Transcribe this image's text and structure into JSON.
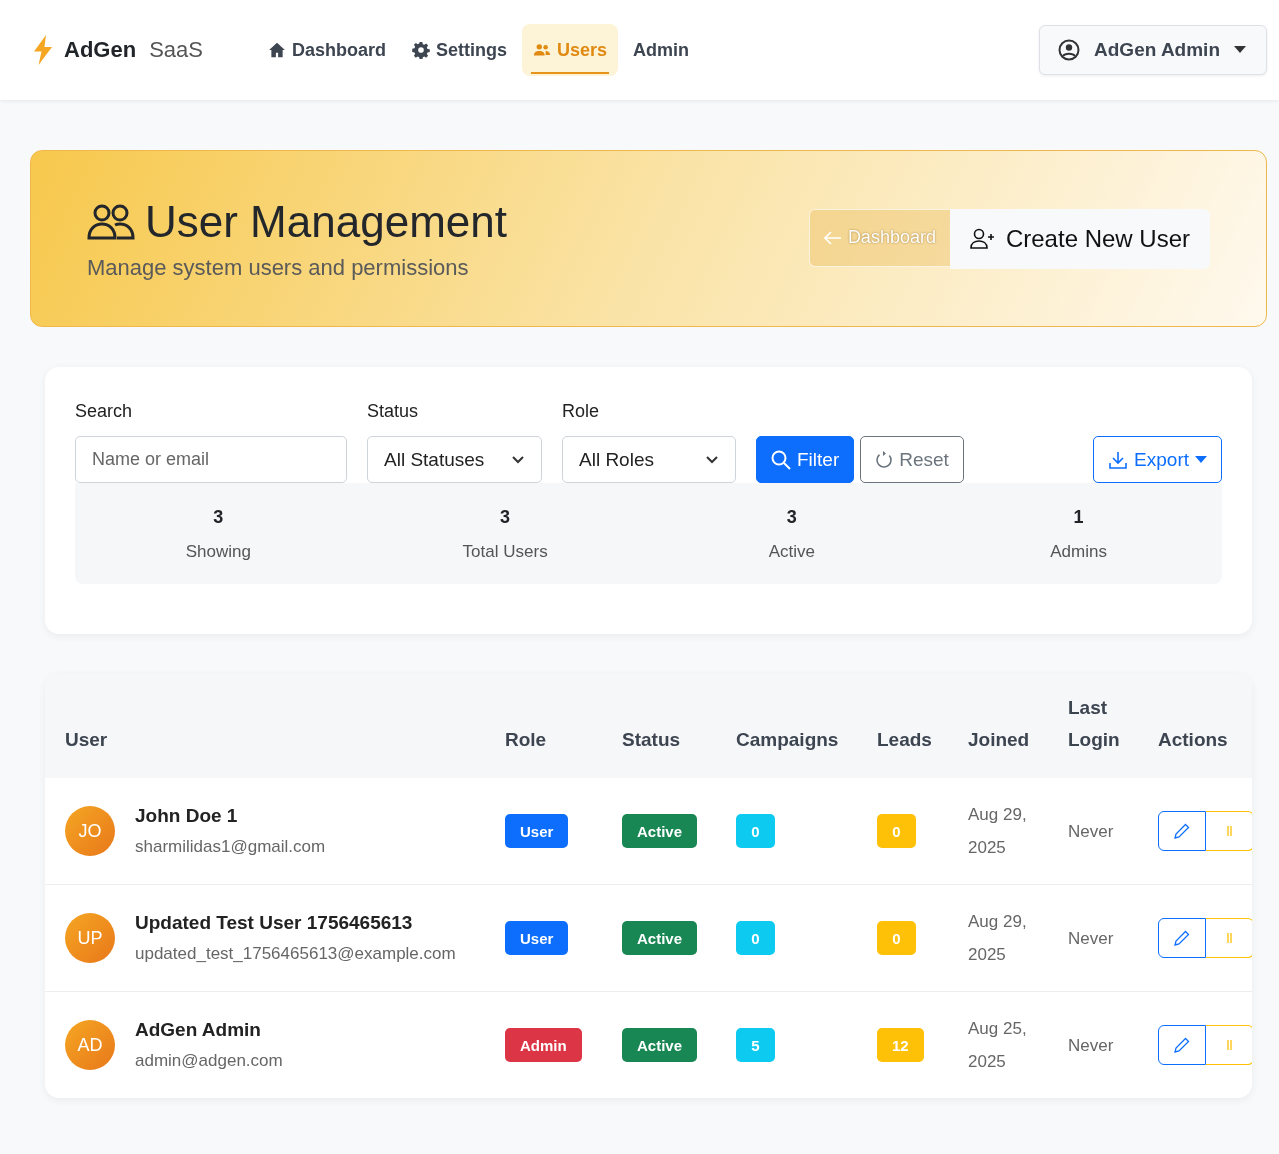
{
  "brand": {
    "name": "AdGen",
    "suffix": "SaaS"
  },
  "nav": [
    {
      "label": "Dashboard",
      "kind": "home",
      "selected": false
    },
    {
      "label": "Settings",
      "kind": "gear",
      "selected": false
    },
    {
      "label": "Users",
      "kind": "users",
      "selected": true
    },
    {
      "label": "Admin",
      "kind": "plain",
      "selected": false
    }
  ],
  "user_menu": {
    "label": "AdGen Admin"
  },
  "hero": {
    "title": "User Management",
    "subtitle": "Manage system users and permissions",
    "back_button": "Dashboard",
    "create_button": "Create New User"
  },
  "filters": {
    "search": {
      "label": "Search",
      "placeholder": "Name or email"
    },
    "status": {
      "label": "Status",
      "value": "All Statuses"
    },
    "role": {
      "label": "Role",
      "value": "All Roles"
    },
    "filter_button": "Filter",
    "reset_button": "Reset",
    "export_button": "Export"
  },
  "stats": [
    {
      "value": "3",
      "label": "Showing"
    },
    {
      "value": "3",
      "label": "Total Users"
    },
    {
      "value": "3",
      "label": "Active"
    },
    {
      "value": "1",
      "label": "Admins"
    }
  ],
  "table": {
    "columns": [
      "User",
      "Role",
      "Status",
      "Campaigns",
      "Leads",
      "Joined",
      "Last Login",
      "Actions"
    ],
    "rows": [
      {
        "initials": "JO",
        "name": "John Doe 1",
        "email": "sharmilidas1@gmail.com",
        "role": {
          "text": "User",
          "kind": "user"
        },
        "status": "Active",
        "campaigns": "0",
        "leads": "0",
        "joined": "Aug 29, 2025",
        "last_login": "Never"
      },
      {
        "initials": "UP",
        "name": "Updated Test User 1756465613",
        "email": "updated_test_1756465613@example.com",
        "role": {
          "text": "User",
          "kind": "user"
        },
        "status": "Active",
        "campaigns": "0",
        "leads": "0",
        "joined": "Aug 29, 2025",
        "last_login": "Never"
      },
      {
        "initials": "AD",
        "name": "AdGen Admin",
        "email": "admin@adgen.com",
        "role": {
          "text": "Admin",
          "kind": "admin"
        },
        "status": "Active",
        "campaigns": "5",
        "leads": "12",
        "joined": "Aug 25, 2025",
        "last_login": "Never"
      }
    ]
  }
}
